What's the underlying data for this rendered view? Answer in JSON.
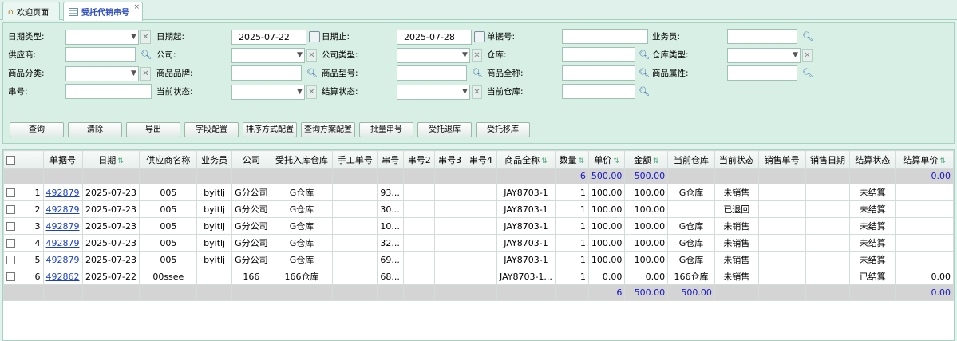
{
  "tabs": [
    {
      "label": "欢迎页面",
      "icon": "home-icon"
    },
    {
      "label": "受托代销串号",
      "icon": "grid-icon",
      "close": "×"
    }
  ],
  "filters": {
    "date_type": {
      "label": "日期类型:",
      "value": ""
    },
    "date_from": {
      "label": "日期起:",
      "value": "2025-07-22"
    },
    "date_to": {
      "label": "日期止:",
      "value": "2025-07-28"
    },
    "doc_no": {
      "label": "单据号:",
      "value": ""
    },
    "salesman": {
      "label": "业务员:",
      "value": ""
    },
    "supplier": {
      "label": "供应商:",
      "value": ""
    },
    "company": {
      "label": "公司:",
      "value": ""
    },
    "company_type": {
      "label": "公司类型:",
      "value": ""
    },
    "warehouse": {
      "label": "仓库:",
      "value": ""
    },
    "warehouse_type": {
      "label": "仓库类型:",
      "value": ""
    },
    "product_category": {
      "label": "商品分类:",
      "value": ""
    },
    "product_brand": {
      "label": "商品品牌:",
      "value": ""
    },
    "product_model": {
      "label": "商品型号:",
      "value": ""
    },
    "product_fullname": {
      "label": "商品全称:",
      "value": ""
    },
    "product_attr": {
      "label": "商品属性:",
      "value": ""
    },
    "serial_no": {
      "label": "串号:",
      "value": ""
    },
    "current_status": {
      "label": "当前状态:",
      "value": ""
    },
    "settle_status": {
      "label": "结算状态:",
      "value": ""
    },
    "current_warehouse": {
      "label": "当前仓库:",
      "value": ""
    }
  },
  "buttons": [
    "查询",
    "清除",
    "导出",
    "字段配置",
    "排序方式配置",
    "查询方案配置",
    "批量串号",
    "受托退库",
    "受托移库"
  ],
  "columns": [
    "",
    "单据号",
    "日期",
    "供应商名称",
    "业务员",
    "公司",
    "受托入库仓库",
    "手工单号",
    "串号",
    "串号2",
    "串号3",
    "串号4",
    "商品全称",
    "数量",
    "单价",
    "金额",
    "当前仓库",
    "当前状态",
    "销售单号",
    "销售日期",
    "结算状态",
    "结算单价"
  ],
  "top_summary": {
    "qty": "6",
    "price": "500.00",
    "amount": "500.00",
    "settle_price": "0.00"
  },
  "rows": [
    {
      "n": "1",
      "doc": "492879",
      "date": "2025-07-23",
      "supplier": "005",
      "salesman": "byitlj",
      "company": "G分公司",
      "in_wh": "G仓库",
      "manual": "",
      "sn": "93...",
      "sn2": "",
      "sn3": "",
      "sn4": "",
      "product": "JAY8703-1",
      "qty": "1",
      "price": "100.00",
      "amount": "100.00",
      "cur_wh": "G仓库",
      "status": "未销售",
      "sale_no": "",
      "sale_date": "",
      "settle": "未结算",
      "settle_price": ""
    },
    {
      "n": "2",
      "doc": "492879",
      "date": "2025-07-23",
      "supplier": "005",
      "salesman": "byitlj",
      "company": "G分公司",
      "in_wh": "G仓库",
      "manual": "",
      "sn": "30...",
      "sn2": "",
      "sn3": "",
      "sn4": "",
      "product": "JAY8703-1",
      "qty": "1",
      "price": "100.00",
      "amount": "100.00",
      "cur_wh": "",
      "status": "已退回",
      "sale_no": "",
      "sale_date": "",
      "settle": "未结算",
      "settle_price": ""
    },
    {
      "n": "3",
      "doc": "492879",
      "date": "2025-07-23",
      "supplier": "005",
      "salesman": "byitlj",
      "company": "G分公司",
      "in_wh": "G仓库",
      "manual": "",
      "sn": "10...",
      "sn2": "",
      "sn3": "",
      "sn4": "",
      "product": "JAY8703-1",
      "qty": "1",
      "price": "100.00",
      "amount": "100.00",
      "cur_wh": "G仓库",
      "status": "未销售",
      "sale_no": "",
      "sale_date": "",
      "settle": "未结算",
      "settle_price": ""
    },
    {
      "n": "4",
      "doc": "492879",
      "date": "2025-07-23",
      "supplier": "005",
      "salesman": "byitlj",
      "company": "G分公司",
      "in_wh": "G仓库",
      "manual": "",
      "sn": "32...",
      "sn2": "",
      "sn3": "",
      "sn4": "",
      "product": "JAY8703-1",
      "qty": "1",
      "price": "100.00",
      "amount": "100.00",
      "cur_wh": "G仓库",
      "status": "未销售",
      "sale_no": "",
      "sale_date": "",
      "settle": "未结算",
      "settle_price": ""
    },
    {
      "n": "5",
      "doc": "492879",
      "date": "2025-07-23",
      "supplier": "005",
      "salesman": "byitlj",
      "company": "G分公司",
      "in_wh": "G仓库",
      "manual": "",
      "sn": "69...",
      "sn2": "",
      "sn3": "",
      "sn4": "",
      "product": "JAY8703-1",
      "qty": "1",
      "price": "100.00",
      "amount": "100.00",
      "cur_wh": "G仓库",
      "status": "未销售",
      "sale_no": "",
      "sale_date": "",
      "settle": "未结算",
      "settle_price": ""
    },
    {
      "n": "6",
      "doc": "492862",
      "date": "2025-07-22",
      "supplier": "00ssee",
      "salesman": "",
      "company": "166",
      "in_wh": "166仓库",
      "manual": "",
      "sn": "68...",
      "sn2": "",
      "sn3": "",
      "sn4": "",
      "product": "JAY8703-1...",
      "qty": "1",
      "price": "0.00",
      "amount": "0.00",
      "cur_wh": "166仓库",
      "status": "未销售",
      "sale_no": "",
      "sale_date": "",
      "settle": "已结算",
      "settle_price": "0.00"
    }
  ],
  "bottom_summary": {
    "qty": "6",
    "price": "500.00",
    "amount": "500.00",
    "settle_price": "0.00"
  },
  "colors": {
    "panel_bg": "#d7efe4",
    "link": "#1a3fcf",
    "summary_text": "#1515cc"
  }
}
